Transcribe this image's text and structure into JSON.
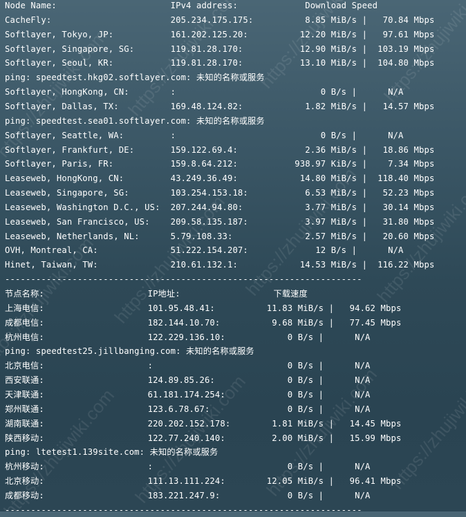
{
  "watermark": "https://zhujiwiki.com",
  "rows": [
    "Node Name:                      IPv4 address:             Download Speed",
    "CacheFly:                       205.234.175.175:          8.85 MiB/s |   70.84 Mbps",
    "Softlayer, Tokyo, JP:           161.202.125.20:          12.20 MiB/s |   97.61 Mbps",
    "Softlayer, Singapore, SG:       119.81.28.170:           12.90 MiB/s |  103.19 Mbps",
    "Softlayer, Seoul, KR:           119.81.28.170:           13.10 MiB/s |  104.80 Mbps",
    "ping: speedtest.hkg02.softlayer.com: 未知的名称或服务",
    "Softlayer, HongKong, CN:        :                            0 B/s |      N/A",
    "Softlayer, Dallas, TX:          169.48.124.82:            1.82 MiB/s |   14.57 Mbps",
    "ping: speedtest.sea01.softlayer.com: 未知的名称或服务",
    "Softlayer, Seattle, WA:         :                            0 B/s |      N/A",
    "Softlayer, Frankfurt, DE:       159.122.69.4:             2.36 MiB/s |   18.86 Mbps",
    "Softlayer, Paris, FR:           159.8.64.212:           938.97 KiB/s |    7.34 Mbps",
    "Leaseweb, HongKong, CN:         43.249.36.49:            14.80 MiB/s |  118.40 Mbps",
    "Leaseweb, Singapore, SG:        103.254.153.18:           6.53 MiB/s |   52.23 Mbps",
    "Leaseweb, Washington D.C., US:  207.244.94.80:            3.77 MiB/s |   30.14 Mbps",
    "Leaseweb, San Francisco, US:    209.58.135.187:           3.97 MiB/s |   31.80 Mbps",
    "Leaseweb, Netherlands, NL:      5.79.108.33:              2.57 MiB/s |   20.60 Mbps",
    "OVH, Montreal, CA:              51.222.154.207:             12 B/s |      N/A",
    "Hinet, Taiwan, TW:              210.61.132.1:            14.53 MiB/s |  116.22 Mbps",
    "---------------------------------------------------------------------",
    "节点名称:                    IP地址:                  下载速度",
    "上海电信:                    101.95.48.41:          11.83 MiB/s |   94.62 Mbps",
    "成都电信:                    182.144.10.70:          9.68 MiB/s |   77.45 Mbps",
    "杭州电信:                    122.229.136.10:            0 B/s |      N/A",
    "ping: speedtest25.jillbanging.com: 未知的名称或服务",
    "北京电信:                    :                          0 B/s |      N/A",
    "西安联通:                    124.89.85.26:              0 B/s |      N/A",
    "天津联通:                    61.181.174.254:            0 B/s |      N/A",
    "郑州联通:                    123.6.78.67:               0 B/s |      N/A",
    "湖南联通:                    220.202.152.178:        1.81 MiB/s |   14.45 Mbps",
    "陕西移动:                    122.77.240.140:         2.00 MiB/s |   15.99 Mbps",
    "ping: ltetest1.139site.com: 未知的名称或服务",
    "杭州移动:                    :                          0 B/s |      N/A",
    "北京移动:                    111.13.111.224:        12.05 MiB/s |   96.41 Mbps",
    "成都移动:                    183.221.247.9:             0 B/s |      N/A",
    "---------------------------------------------------------------------"
  ]
}
